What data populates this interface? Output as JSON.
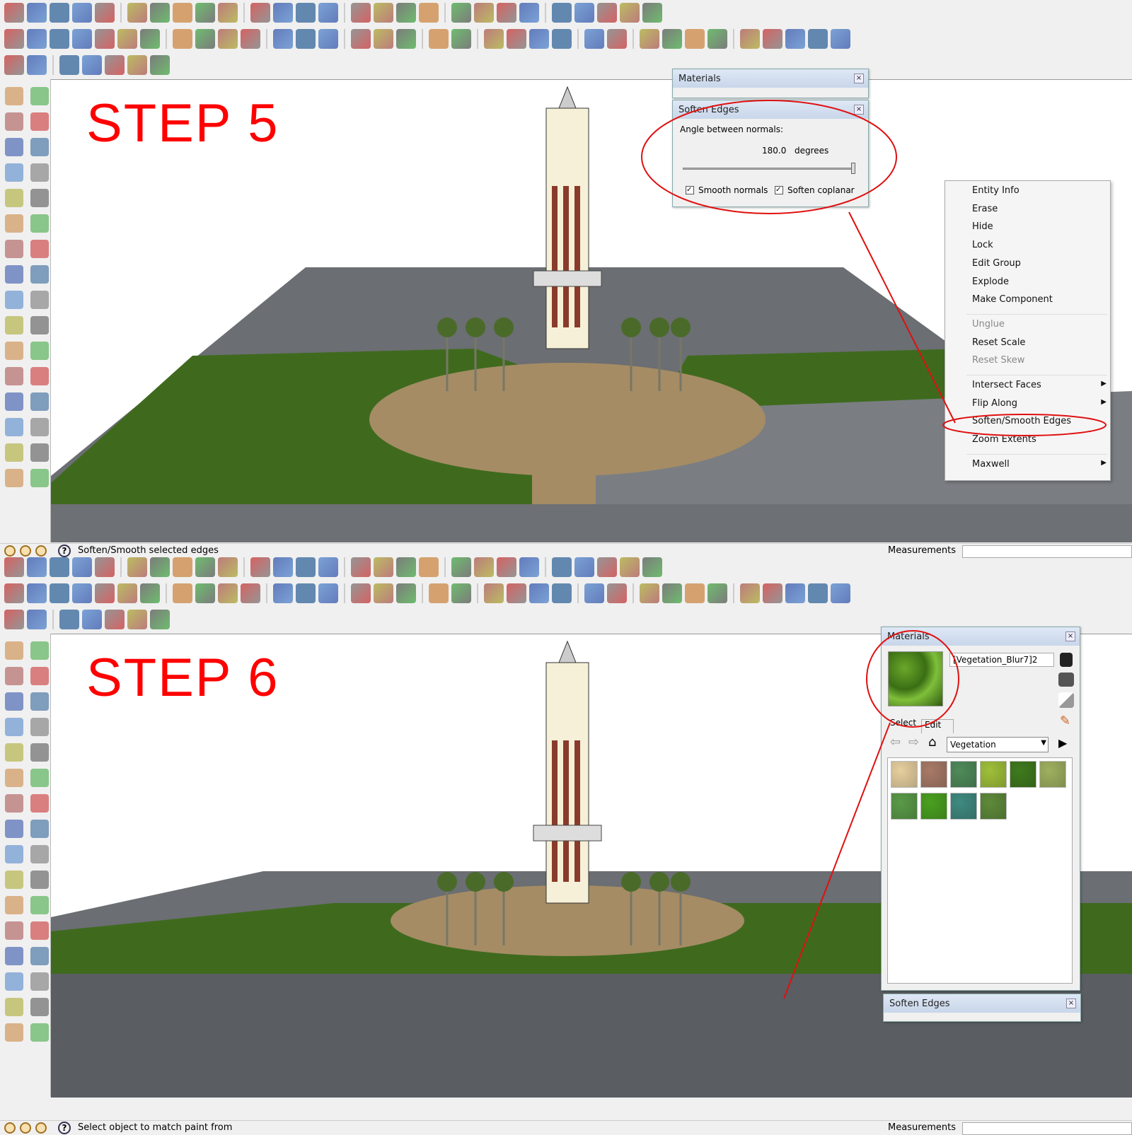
{
  "panels": [
    {
      "step_label": "STEP 5",
      "status_text": "Soften/Smooth selected edges",
      "measurements_label": "Measurements"
    },
    {
      "step_label": "STEP 6",
      "status_text": "Select object to match paint from",
      "measurements_label": "Measurements"
    }
  ],
  "step5": {
    "materials_title": "Materials",
    "soften_dialog": {
      "title": "Soften Edges",
      "angle_label": "Angle between normals:",
      "angle_value": "180.0",
      "angle_unit": "degrees",
      "slider_fraction": 1.0,
      "smooth_normals_label": "Smooth normals",
      "smooth_normals_checked": true,
      "soften_coplanar_label": "Soften coplanar",
      "soften_coplanar_checked": true
    },
    "context_menu": [
      {
        "label": "Entity Info"
      },
      {
        "label": "Erase"
      },
      {
        "label": "Hide"
      },
      {
        "label": "Lock"
      },
      {
        "label": "Edit Group"
      },
      {
        "label": "Explode"
      },
      {
        "label": "Make Component"
      },
      {
        "label": "Unglue",
        "disabled": true
      },
      {
        "label": "Reset Scale"
      },
      {
        "label": "Reset Skew",
        "disabled": true
      },
      {
        "label": "Intersect Faces",
        "submenu": true
      },
      {
        "label": "Flip Along",
        "submenu": true
      },
      {
        "label": "Soften/Smooth Edges",
        "highlighted": true
      },
      {
        "label": "Zoom Extents"
      },
      {
        "label": "Maxwell",
        "submenu": true
      }
    ]
  },
  "step6": {
    "materials": {
      "title": "Materials",
      "material_name": "[Vegetation_Blur7]2",
      "tabs": [
        "Select",
        "Edit"
      ],
      "library": "Vegetation",
      "swatches": [
        "#e6cf9f",
        "#a87a68",
        "#4f8a5a",
        "#9fbf3a",
        "#3f7a1e",
        "#9fb060",
        "#5a9a48",
        "#4aa020",
        "#3f8a80",
        "#5e8a3a"
      ]
    },
    "soften_collapsed_title": "Soften Edges"
  },
  "colors": {
    "annotation_red": "#e01010",
    "step_text": "#ff0000",
    "grass": "#3f6a1e",
    "ground_gray": "#6b6e72",
    "plaza": "#a58c64"
  }
}
